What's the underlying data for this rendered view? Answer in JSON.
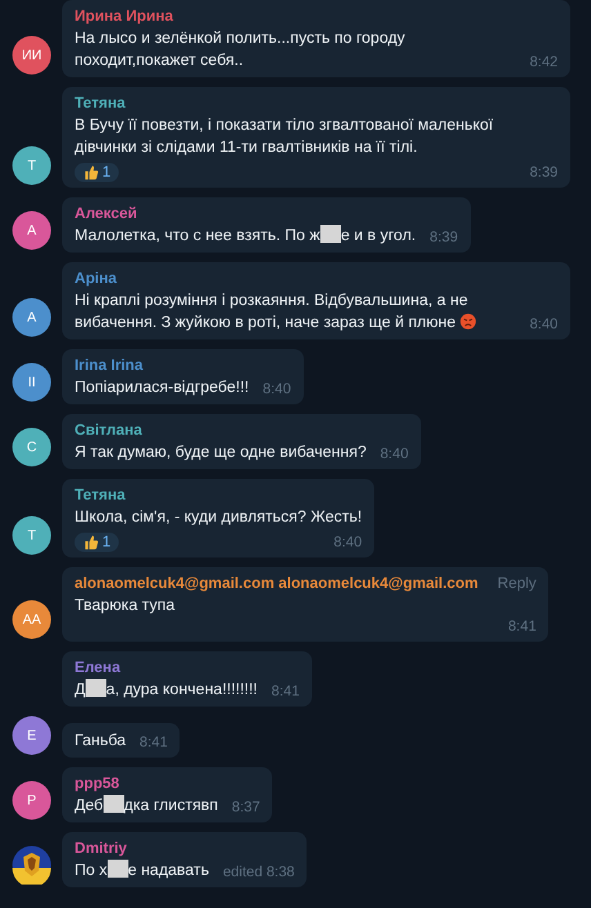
{
  "messages": [
    {
      "author": "Ирина Ирина",
      "avatar": {
        "kind": "initials",
        "text": "ИИ"
      },
      "color": "#e0525e",
      "parts": [
        {
          "kind": "text",
          "text": "На лысо и зелёнкой полить...пусть по городу походит,покажет себя.."
        }
      ],
      "time": "8:42"
    },
    {
      "author": "Тетяна",
      "avatar": {
        "kind": "initials",
        "text": "Т"
      },
      "color": "#4fb0b8",
      "parts": [
        {
          "kind": "text",
          "text": "В Бучу її повезти, і показати тіло згвалтованої маленької дівчинки зі слідами 11-ти гвалтівників на її тілі."
        }
      ],
      "reaction": {
        "count": "1"
      },
      "time": "8:39"
    },
    {
      "author": "Алексей",
      "avatar": {
        "kind": "initials",
        "text": "А"
      },
      "color": "#d9579a",
      "parts": [
        {
          "kind": "text",
          "text": "Малолетка, что с нее взять. По ж"
        },
        {
          "kind": "redaction"
        },
        {
          "kind": "text",
          "text": "е и в угол."
        }
      ],
      "time": "8:39"
    },
    {
      "author": "Аріна",
      "avatar": {
        "kind": "initials",
        "text": "А"
      },
      "color": "#4c8fcc",
      "parts": [
        {
          "kind": "text",
          "text": "Ні краплі розуміння і розкаяння. Відбувальшина, а не вибачення. З жуйкою в роті, наче зараз ще й плюне "
        },
        {
          "kind": "emoji"
        }
      ],
      "time": "8:40"
    },
    {
      "author": "Irina Irina",
      "avatar": {
        "kind": "initials",
        "text": "II"
      },
      "color": "#4c8fcc",
      "parts": [
        {
          "kind": "text",
          "text": "Попіарилася-відгребе!!!"
        }
      ],
      "time": "8:40"
    },
    {
      "author": "Світлана",
      "avatar": {
        "kind": "initials",
        "text": "С"
      },
      "color": "#4fb0b8",
      "parts": [
        {
          "kind": "text",
          "text": "Я так думаю, буде ще одне вибачення?"
        }
      ],
      "time": "8:40"
    },
    {
      "author": "Тетяна",
      "avatar": {
        "kind": "initials",
        "text": "Т"
      },
      "color": "#4fb0b8",
      "parts": [
        {
          "kind": "text",
          "text": "Школа, сім'я, - куди дивляться? Жесть!"
        }
      ],
      "reaction": {
        "count": "1"
      },
      "time": "8:40"
    },
    {
      "author": "alonaomelcuk4@gmail.com alonaomelcuk4@gmail.com",
      "avatar": {
        "kind": "initials",
        "text": "AA"
      },
      "color": "#e8893a",
      "reply": "Reply",
      "parts": [
        {
          "kind": "text",
          "text": "Тварюка тупа"
        }
      ],
      "time": "8:41"
    },
    {
      "author": "Елена",
      "color": "#8e78d6",
      "parts": [
        {
          "kind": "text",
          "text": "Д"
        },
        {
          "kind": "redaction"
        },
        {
          "kind": "text",
          "text": "а, дура кончена!!!!!!!!"
        }
      ],
      "time": "8:41"
    },
    {
      "avatar": {
        "kind": "initials",
        "text": "Е"
      },
      "color": "#8e78d6",
      "parts": [
        {
          "kind": "text",
          "text": "Ганьба"
        }
      ],
      "time": "8:41"
    },
    {
      "author": "ppp58",
      "avatar": {
        "kind": "initials",
        "text": "P"
      },
      "color": "#d9579a",
      "parts": [
        {
          "kind": "text",
          "text": "Деб"
        },
        {
          "kind": "redaction"
        },
        {
          "kind": "text",
          "text": "дка глистявп"
        }
      ],
      "time": "8:37"
    },
    {
      "author": "Dmitriy",
      "color": "#d9579a",
      "parts": [
        {
          "kind": "text",
          "text": "По х"
        },
        {
          "kind": "redaction"
        },
        {
          "kind": "text",
          "text": "е надавать"
        }
      ],
      "time": "edited 8:38"
    }
  ]
}
